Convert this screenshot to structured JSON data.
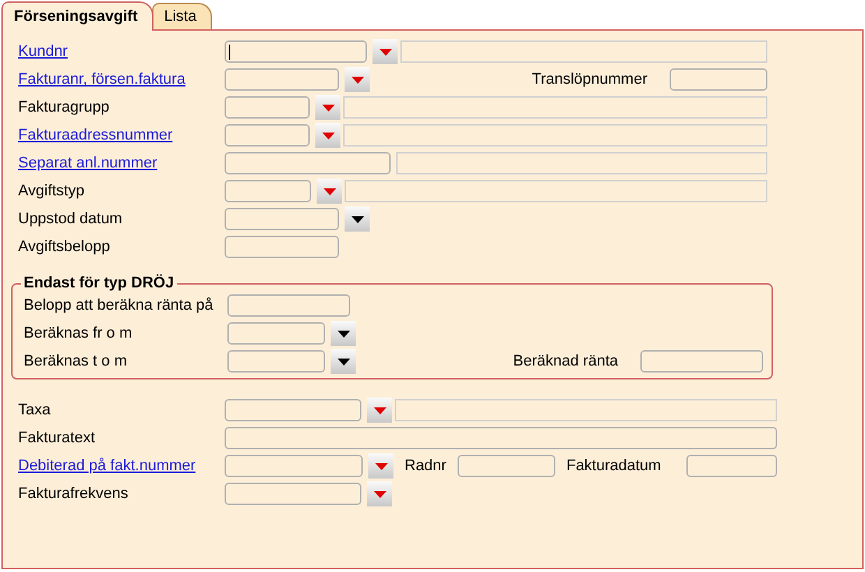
{
  "tabs": [
    {
      "label": "Förseningsavgift",
      "selected": true
    },
    {
      "label": "Lista",
      "selected": false
    }
  ],
  "rows": [
    {
      "label": "Kundnr",
      "link": true,
      "items": [
        {
          "kind": "input",
          "focused": true
        },
        {
          "kind": "list-button"
        },
        {
          "kind": "display"
        }
      ]
    },
    {
      "label": "Fakturanr, försen.faktura",
      "link": true,
      "items": [
        {
          "kind": "input",
          "focused": false
        },
        {
          "kind": "list-button"
        },
        {
          "kind": "label",
          "text": "Translöpnummer"
        },
        {
          "kind": "input",
          "focused": false
        }
      ]
    },
    {
      "label": "Fakturagrupp",
      "link": false,
      "items": [
        {
          "kind": "input",
          "focused": false
        },
        {
          "kind": "list-button"
        },
        {
          "kind": "display"
        }
      ]
    },
    {
      "label": "Fakturaadressnummer",
      "link": true,
      "items": [
        {
          "kind": "input",
          "focused": false
        },
        {
          "kind": "list-button"
        },
        {
          "kind": "display"
        }
      ]
    },
    {
      "label": "Separat anl.nummer",
      "link": true,
      "items": [
        {
          "kind": "input",
          "focused": false
        },
        {
          "kind": "display"
        }
      ]
    },
    {
      "label": "Avgiftstyp",
      "link": false,
      "items": [
        {
          "kind": "input",
          "focused": false
        },
        {
          "kind": "list-button"
        },
        {
          "kind": "display"
        }
      ]
    },
    {
      "label": "Uppstod datum",
      "link": false,
      "items": [
        {
          "kind": "input",
          "focused": false
        },
        {
          "kind": "date-button"
        }
      ]
    },
    {
      "label": "Avgiftsbelopp",
      "link": false,
      "items": [
        {
          "kind": "input",
          "focused": false
        }
      ]
    }
  ],
  "group": {
    "title": "Endast för typ DRÖJ",
    "rows": [
      {
        "label": "Belopp att beräkna ränta på",
        "link": false,
        "items": [
          {
            "kind": "input",
            "focused": false
          }
        ]
      },
      {
        "label": "Beräknas fr o m",
        "link": false,
        "items": [
          {
            "kind": "input",
            "focused": false
          },
          {
            "kind": "date-button"
          }
        ]
      },
      {
        "label": "Beräknas t o m",
        "link": false,
        "items": [
          {
            "kind": "input",
            "focused": false
          },
          {
            "kind": "date-button"
          },
          {
            "kind": "label",
            "text": "Beräknad ränta"
          },
          {
            "kind": "input",
            "focused": false
          }
        ]
      }
    ]
  },
  "bottom_rows": [
    {
      "label": "Taxa",
      "link": false,
      "items": [
        {
          "kind": "input",
          "focused": false
        },
        {
          "kind": "list-button"
        },
        {
          "kind": "display"
        }
      ]
    },
    {
      "label": "Fakturatext",
      "link": false,
      "items": [
        {
          "kind": "input",
          "focused": false
        }
      ]
    },
    {
      "label": "Debiterad på fakt.nummer",
      "link": true,
      "items": [
        {
          "kind": "input",
          "focused": false
        },
        {
          "kind": "list-button"
        },
        {
          "kind": "label",
          "text": "Radnr"
        },
        {
          "kind": "input",
          "focused": false
        },
        {
          "kind": "label",
          "text": "Fakturadatum"
        },
        {
          "kind": "input",
          "focused": false
        }
      ]
    },
    {
      "label": "Fakturafrekvens",
      "link": false,
      "items": [
        {
          "kind": "input",
          "focused": false
        },
        {
          "kind": "list-button"
        }
      ]
    }
  ]
}
